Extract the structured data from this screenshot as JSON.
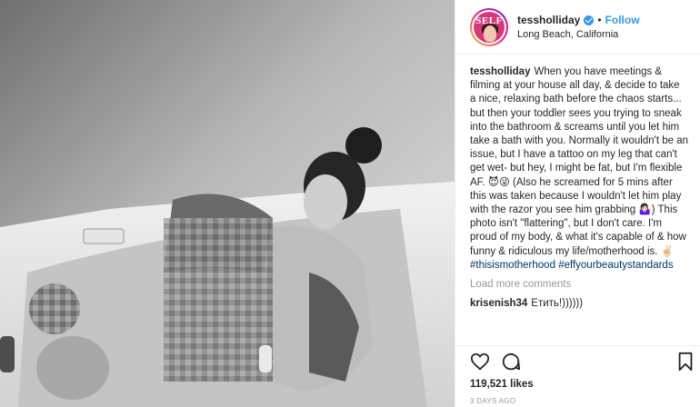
{
  "header": {
    "username": "tessholliday",
    "separator": "•",
    "follow_label": "Follow",
    "location": "Long Beach, California",
    "avatar_logo_text": "SELF",
    "verified_icon": "verified-badge-icon"
  },
  "caption": {
    "username": "tessholliday",
    "text_part1": "When you have meetings & filming at your house all day, & decide to take a nice, relaxing bath before the chaos starts... but then your toddler sees you trying to sneak into the bathroom & screams until you let him take a bath with you. Normally it wouldn't be an issue, but I have a tattoo on my leg that can't get wet- but hey, I might be fat, but I'm flexible AF.",
    "emoji_1": "😈😜",
    "text_part2": "(Also he screamed for 5 mins after this was taken because I wouldn't let him play with the razor you see him grabbing",
    "emoji_2": "🤷🏻‍♀️",
    "text_part3": ") This photo isn't \"flattering\", but I don't care. I'm proud of my body, & what it's capable of & how funny & ridiculous my life/motherhood is.",
    "emoji_3": "✌🏻",
    "hashtag_1": "#thisismotherhood",
    "hashtag_2": "#effyourbeautystandards"
  },
  "load_more_label": "Load more comments",
  "comments": [
    {
      "username": "krisenish34",
      "text": "Етить!))))))"
    }
  ],
  "actions": {
    "like_icon": "heart-icon",
    "comment_icon": "comment-bubble-icon",
    "save_icon": "bookmark-icon"
  },
  "likes": "119,521 likes",
  "timestamp": "3 DAYS AGO",
  "colors": {
    "link": "#003569",
    "follow": "#3897f0",
    "muted": "#999999",
    "text": "#262626"
  }
}
